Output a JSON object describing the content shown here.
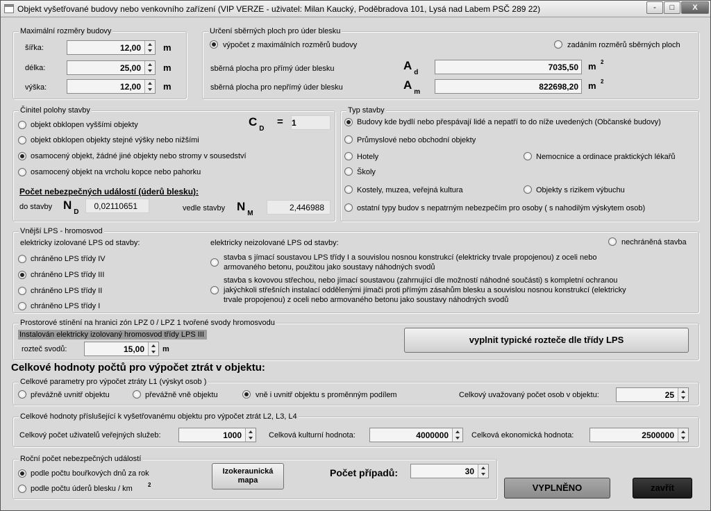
{
  "window": {
    "title": "Objekt vyšetřované budovy nebo venkovního zařízení (VIP VERZE - uživatel: Milan Kaucký, Poděbradova 101, Lysá nad Labem PSČ 289 22)",
    "controls": {
      "minimize": "-",
      "maximize": "□",
      "close": "X"
    }
  },
  "dims": {
    "legend": "Maximální rozměry budovy",
    "rows": [
      {
        "label": "šířka:",
        "value": "12,00",
        "unit": "m"
      },
      {
        "label": "délka:",
        "value": "25,00",
        "unit": "m"
      },
      {
        "label": "výška:",
        "value": "12,00",
        "unit": "m"
      }
    ]
  },
  "areas": {
    "legend": "Určení sběrných ploch pro úder blesku",
    "opt1": "výpočet z maximálních rozměrů budovy",
    "opt2": "zadáním rozměrů sběrných ploch",
    "direct_label": "sběrná plocha pro přímý úder blesku",
    "direct_sym": "A",
    "direct_sub": "d",
    "direct_value": "7035,50",
    "indirect_label": "sběrná plocha pro nepřímý úder blesku",
    "indirect_sym": "A",
    "indirect_sub": "m",
    "indirect_value": "822698,20",
    "unit": "m",
    "unit_sup": "2"
  },
  "position": {
    "legend": "Činitel polohy stavby",
    "options": [
      "objekt obklopen vyššími objekty",
      "objekt obklopen objekty stejné výšky nebo nižšími",
      "osamocený objekt, žádné jiné objekty nebo stromy v sousedství",
      "osamocený objekt na vrcholu kopce nebo pahorku"
    ],
    "cd_sym": "C",
    "cd_sub": "D",
    "eq": "=",
    "cd_value": "1",
    "events_heading": "Počet nebezpečných událostí (úderů blesku):",
    "nd_label": "do stavby",
    "nd_sym": "N",
    "nd_sub": "D",
    "nd_value": "0,02110651",
    "nm_label": "vedle stavby",
    "nm_sym": "N",
    "nm_sub": "M",
    "nm_value": "2,446988"
  },
  "type": {
    "legend": "Typ stavby",
    "opt1": "Budovy kde bydlí nebo přespávají lidé a nepatří to do níže uvedených (Občanské budovy)",
    "opt2": "Průmyslové nebo obchodní objekty",
    "opt3": "Hotely",
    "opt4": "Nemocnice a ordinace praktických lékařů",
    "opt5": "Školy",
    "opt6": "Kostely, muzea, veřejná  kultura",
    "opt7": "Objekty s rizikem výbuchu",
    "opt8": "ostatní typy budov s nepatrným nebezpečím pro osoby ( s nahodilým výskytem osob)"
  },
  "lps": {
    "legend": "Vnější LPS - hromosvod",
    "isolated_heading": "elektricky izolované LPS od stavby:",
    "isolated": [
      "chráněno LPS třídy IV",
      "chráněno LPS třídy III",
      "chráněno LPS třídy II",
      "chráněno LPS třídy I"
    ],
    "nonisolated_heading": "elektricky neizolované LPS od stavby:",
    "unprotected": "nechráněná stavba",
    "ni1_l1": "stavba s jímací soustavou LPS třídy I a souvislou nosnou konstrukcí (elektricky trvale propojenou) z oceli nebo",
    "ni1_l2": "armovaného betonu, použitou jako soustavy náhodných svodů",
    "ni2_l1": "stavba s kovovou střechou,  nebo jímací soustavou (zahrnující dle možností náhodné součásti) s kompletní ochranou",
    "ni2_l2": "jakýchkoli střešních instalací oddělenými jímači proti přímým zásahům blesku a souvislou nosnou konstrukcí (elektricky",
    "ni2_l3": "trvale propojenou) z oceli nebo armovaného betonu jako soustavy náhodných svodů"
  },
  "shield": {
    "legend": "Prostorové stínění na hranici zón LPZ 0 / LPZ 1   tvořené svody hromosvodu",
    "installed": "Instalován elektricky izolovaný hromosvod třídy LPS III",
    "spacing_label": "rozteč svodů:",
    "spacing_value": "15,00",
    "unit": "m",
    "fill_button": "vyplnit typické rozteče dle třídy LPS"
  },
  "totals_heading": "Celkové hodnoty počtů pro výpočet ztrát v objektu:",
  "l1": {
    "legend": "Celkové parametry pro výpočet ztráty L1 (výskyt osob )",
    "opt1": "převážně uvnitř objektu",
    "opt2": "převážně vně objektu",
    "opt3": "vně i uvnitř objektu s proměnným podílem",
    "persons_label": "Celkový uvažovaný počet osob v objektu:",
    "persons_value": "25"
  },
  "l234": {
    "legend": "Celkové hodnoty příslušející k vyšetřovanému objektu pro výpočet ztrát L2, L3, L4",
    "users_label": "Celkový počet uživatelů veřejných služeb:",
    "users_value": "1000",
    "culture_label": "Celková kulturní hodnota:",
    "culture_value": "4000000",
    "economic_label": "Celková ekonomická hodnota:",
    "economic_value": "2500000"
  },
  "annual": {
    "legend": "Roční počet nebezpečných událostí",
    "opt1": "podle počtu bouřkových dnů za rok",
    "opt2": "podle počtu úderů blesku / km",
    "opt2_sup": "2",
    "map_l1": "Izokeraunická",
    "map_l2": "mapa",
    "cases_label": "Počet případů:",
    "cases_value": "30"
  },
  "buttons": {
    "done": "VYPLNĚNO",
    "close": "zavřít"
  }
}
